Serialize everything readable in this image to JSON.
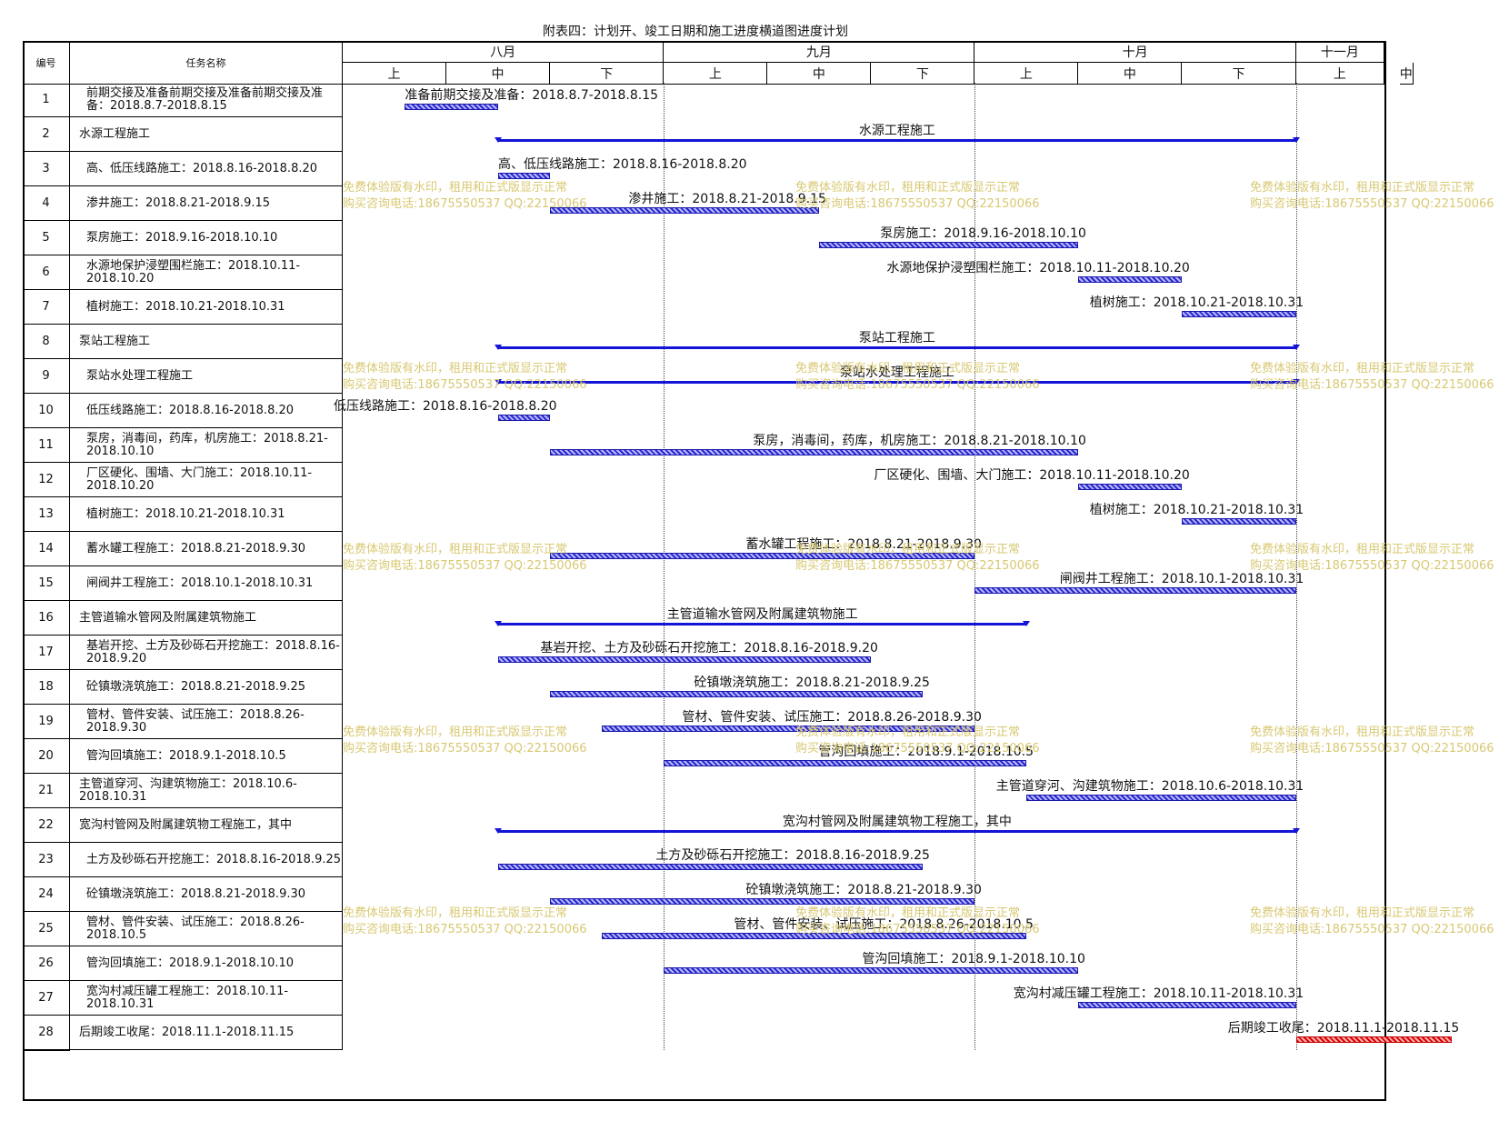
{
  "title": "附表四：计划开、竣工日期和施工进度横道图进度计划",
  "header": {
    "no": "编号",
    "task": "任务名称"
  },
  "timeline": {
    "months": [
      "八月",
      "九月",
      "十月",
      "十一月"
    ],
    "periods": [
      "上",
      "中",
      "下",
      "上",
      "中",
      "下",
      "上",
      "中",
      "下",
      "上",
      "中"
    ]
  },
  "watermark": {
    "line1": "免费体验版有水印，租用和正式版显示正常",
    "line2": "购买咨询电话:18675550537 QQ:22150066"
  },
  "tasks": [
    {
      "no": "1",
      "name": "前期交接及准备前期交接及准备前期交接及准备：2018.8.7-2018.8.15",
      "bar_label": "准备前期交接及准备：2018.8.7-2018.8.15",
      "start": "2018-08-07",
      "end": "2018-08-15",
      "kind": "task",
      "indent": true
    },
    {
      "no": "2",
      "name": "水源工程施工",
      "bar_label": "水源工程施工",
      "start": "2018-08-16",
      "end": "2018-10-31",
      "kind": "summary",
      "indent": false
    },
    {
      "no": "3",
      "name": "高、低压线路施工：2018.8.16-2018.8.20",
      "bar_label": "高、低压线路施工：2018.8.16-2018.8.20",
      "start": "2018-08-16",
      "end": "2018-08-20",
      "kind": "task",
      "indent": true
    },
    {
      "no": "4",
      "name": "渗井施工：2018.8.21-2018.9.15",
      "bar_label": "渗井施工：2018.8.21-2018.9.15",
      "start": "2018-08-21",
      "end": "2018-09-15",
      "kind": "task",
      "indent": true
    },
    {
      "no": "5",
      "name": "泵房施工：2018.9.16-2018.10.10",
      "bar_label": "泵房施工：2018.9.16-2018.10.10",
      "start": "2018-09-16",
      "end": "2018-10-10",
      "kind": "task",
      "indent": true
    },
    {
      "no": "6",
      "name": "水源地保护浸塑围栏施工：2018.10.11-2018.10.20",
      "bar_label": "水源地保护浸塑围栏施工：2018.10.11-2018.10.20",
      "start": "2018-10-11",
      "end": "2018-10-20",
      "kind": "task",
      "indent": true
    },
    {
      "no": "7",
      "name": "植树施工：2018.10.21-2018.10.31",
      "bar_label": "植树施工：2018.10.21-2018.10.31",
      "start": "2018-10-21",
      "end": "2018-10-31",
      "kind": "task",
      "indent": true
    },
    {
      "no": "8",
      "name": "泵站工程施工",
      "bar_label": "泵站工程施工",
      "start": "2018-08-16",
      "end": "2018-10-31",
      "kind": "summary",
      "indent": false
    },
    {
      "no": "9",
      "name": "泵站水处理工程施工",
      "bar_label": "泵站水处理工程施工",
      "start": "2018-08-16",
      "end": "2018-10-31",
      "kind": "summary",
      "indent": true
    },
    {
      "no": "10",
      "name": "低压线路施工：2018.8.16-2018.8.20",
      "bar_label": "低压线路施工：2018.8.16-2018.8.20",
      "start": "2018-08-16",
      "end": "2018-08-20",
      "kind": "task",
      "indent": true
    },
    {
      "no": "11",
      "name": "泵房，消毒间，药库，机房施工：2018.8.21-2018.10.10",
      "bar_label": "泵房，消毒间，药库，机房施工：2018.8.21-2018.10.10",
      "start": "2018-08-21",
      "end": "2018-10-10",
      "kind": "task",
      "indent": true
    },
    {
      "no": "12",
      "name": "厂区硬化、围墙、大门施工：2018.10.11-2018.10.20",
      "bar_label": "厂区硬化、围墙、大门施工：2018.10.11-2018.10.20",
      "start": "2018-10-11",
      "end": "2018-10-20",
      "kind": "task",
      "indent": true
    },
    {
      "no": "13",
      "name": "植树施工：2018.10.21-2018.10.31",
      "bar_label": "植树施工：2018.10.21-2018.10.31",
      "start": "2018-10-21",
      "end": "2018-10-31",
      "kind": "task",
      "indent": true
    },
    {
      "no": "14",
      "name": "蓄水罐工程施工：2018.8.21-2018.9.30",
      "bar_label": "蓄水罐工程施工：2018.8.21-2018.9.30",
      "start": "2018-08-21",
      "end": "2018-09-30",
      "kind": "task",
      "indent": true
    },
    {
      "no": "15",
      "name": "闸阀井工程施工：2018.10.1-2018.10.31",
      "bar_label": "闸阀井工程施工：2018.10.1-2018.10.31",
      "start": "2018-10-01",
      "end": "2018-10-31",
      "kind": "task",
      "indent": true
    },
    {
      "no": "16",
      "name": "主管道输水管网及附属建筑物施工",
      "bar_label": "主管道输水管网及附属建筑物施工",
      "start": "2018-08-16",
      "end": "2018-10-05",
      "kind": "summary",
      "indent": false
    },
    {
      "no": "17",
      "name": "基岩开挖、土方及砂砾石开挖施工：2018.8.16-2018.9.20",
      "bar_label": "基岩开挖、土方及砂砾石开挖施工：2018.8.16-2018.9.20",
      "start": "2018-08-16",
      "end": "2018-09-20",
      "kind": "task",
      "indent": true
    },
    {
      "no": "18",
      "name": "砼镇墩浇筑施工：2018.8.21-2018.9.25",
      "bar_label": "砼镇墩浇筑施工：2018.8.21-2018.9.25",
      "start": "2018-08-21",
      "end": "2018-09-25",
      "kind": "task",
      "indent": true
    },
    {
      "no": "19",
      "name": "管材、管件安装、试压施工：2018.8.26-2018.9.30",
      "bar_label": "管材、管件安装、试压施工：2018.8.26-2018.9.30",
      "start": "2018-08-26",
      "end": "2018-09-30",
      "kind": "task",
      "indent": true
    },
    {
      "no": "20",
      "name": "管沟回填施工：2018.9.1-2018.10.5",
      "bar_label": "管沟回填施工：2018.9.1-2018.10.5",
      "start": "2018-09-01",
      "end": "2018-10-05",
      "kind": "task",
      "indent": true
    },
    {
      "no": "21",
      "name": "主管道穿河、沟建筑物施工：2018.10.6-2018.10.31",
      "bar_label": "主管道穿河、沟建筑物施工：2018.10.6-2018.10.31",
      "start": "2018-10-06",
      "end": "2018-10-31",
      "kind": "task",
      "indent": false
    },
    {
      "no": "22",
      "name": "宽沟村管网及附属建筑物工程施工，其中",
      "bar_label": "宽沟村管网及附属建筑物工程施工，其中",
      "start": "2018-08-16",
      "end": "2018-10-31",
      "kind": "summary",
      "indent": false
    },
    {
      "no": "23",
      "name": "土方及砂砾石开挖施工：2018.8.16-2018.9.25",
      "bar_label": "土方及砂砾石开挖施工：2018.8.16-2018.9.25",
      "start": "2018-08-16",
      "end": "2018-09-25",
      "kind": "task",
      "indent": true
    },
    {
      "no": "24",
      "name": "砼镇墩浇筑施工：2018.8.21-2018.9.30",
      "bar_label": "砼镇墩浇筑施工：2018.8.21-2018.9.30",
      "start": "2018-08-21",
      "end": "2018-09-30",
      "kind": "task",
      "indent": true
    },
    {
      "no": "25",
      "name": "管材、管件安装、试压施工：2018.8.26-2018.10.5",
      "bar_label": "管材、管件安装、试压施工：2018.8.26-2018.10.5",
      "start": "2018-08-26",
      "end": "2018-10-05",
      "kind": "task",
      "indent": true
    },
    {
      "no": "26",
      "name": "管沟回填施工：2018.9.1-2018.10.10",
      "bar_label": "管沟回填施工：2018.9.1-2018.10.10",
      "start": "2018-09-01",
      "end": "2018-10-10",
      "kind": "task",
      "indent": true
    },
    {
      "no": "27",
      "name": "宽沟村减压罐工程施工：2018.10.11-2018.10.31",
      "bar_label": "宽沟村减压罐工程施工：2018.10.11-2018.10.31",
      "start": "2018-10-11",
      "end": "2018-10-31",
      "kind": "task",
      "indent": true
    },
    {
      "no": "28",
      "name": "后期竣工收尾：2018.11.1-2018.11.15",
      "bar_label": "后期竣工收尾：2018.11.1-2018.11.15",
      "start": "2018-11-01",
      "end": "2018-11-15",
      "kind": "critical",
      "indent": false
    }
  ],
  "colors": {
    "bar": "#2a2ad0",
    "summary": "#1414d8",
    "critical": "#e00000",
    "watermark": "#d8c872"
  },
  "chart_data": {
    "type": "gantt",
    "title": "附表四：计划开、竣工日期和施工进度横道图进度计划",
    "x_axis": {
      "months": [
        "八月",
        "九月",
        "十月",
        "十一月"
      ],
      "periods": [
        "上",
        "中",
        "下"
      ],
      "range": [
        "2018-08-01",
        "2018-11-20"
      ]
    },
    "grid": true
  }
}
